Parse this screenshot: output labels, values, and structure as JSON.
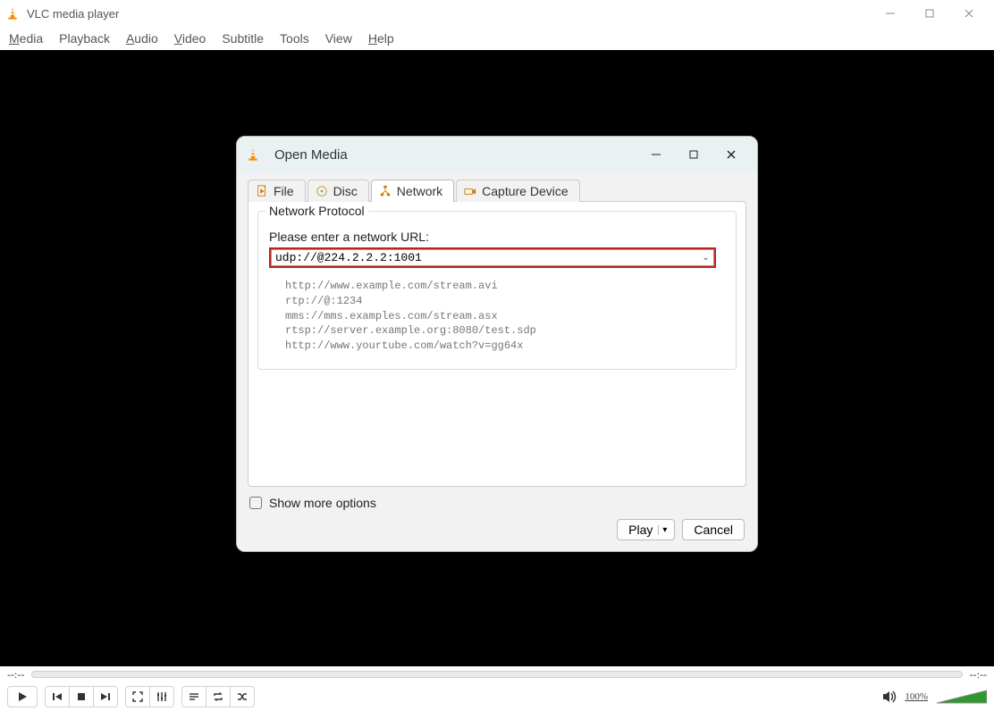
{
  "window": {
    "title": "VLC media player",
    "menu": [
      "Media",
      "Playback",
      "Audio",
      "Video",
      "Subtitle",
      "Tools",
      "View",
      "Help"
    ],
    "menu_underlined": {
      "Media": 0,
      "Audio": 0,
      "Video": 0,
      "Help": 0
    }
  },
  "dialog": {
    "title": "Open Media",
    "tabs": {
      "file": "File",
      "disc": "Disc",
      "network": "Network",
      "capture": "Capture Device"
    },
    "active_tab": "network",
    "group_legend": "Network Protocol",
    "url_label": "Please enter a network URL:",
    "url_value": "udp://@224.2.2.2:1001",
    "examples": "http://www.example.com/stream.avi\nrtp://@:1234\nmms://mms.examples.com/stream.asx\nrtsp://server.example.org:8080/test.sdp\nhttp://www.yourtube.com/watch?v=gg64x",
    "show_more_label": "Show more options",
    "play_label": "Play",
    "cancel_label": "Cancel"
  },
  "transport": {
    "time_left": "--:--",
    "time_right": "--:--",
    "volume_label": "100%"
  }
}
